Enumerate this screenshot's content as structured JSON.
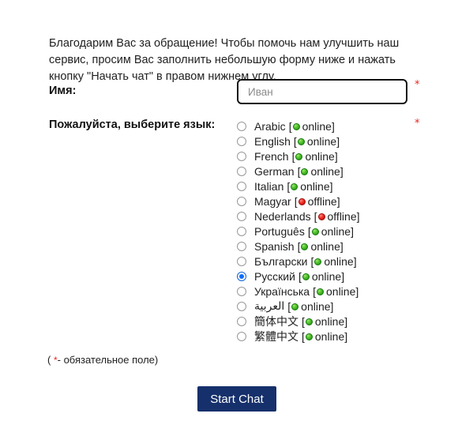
{
  "intro": {
    "text": "Благодарим Вас за обращение! Чтобы помочь нам улучшить наш сервис, просим Вас заполнить небольшую форму ниже и нажать кнопку \"Начать чат\" в правом нижнем углу."
  },
  "form": {
    "name_label": "Имя:",
    "name_value": "",
    "name_placeholder": "Иван",
    "language_label": "Пожалуйста, выберите язык:",
    "required_marker": "*"
  },
  "languages": [
    {
      "label": "Arabic",
      "status": "online",
      "status_text": "online",
      "selected": false
    },
    {
      "label": "English",
      "status": "online",
      "status_text": "online",
      "selected": false
    },
    {
      "label": "French",
      "status": "online",
      "status_text": "online",
      "selected": false
    },
    {
      "label": "German",
      "status": "online",
      "status_text": "online",
      "selected": false
    },
    {
      "label": "Italian",
      "status": "online",
      "status_text": "online",
      "selected": false
    },
    {
      "label": "Magyar",
      "status": "offline",
      "status_text": "offline",
      "selected": false
    },
    {
      "label": "Nederlands",
      "status": "offline",
      "status_text": "offline",
      "selected": false
    },
    {
      "label": "Português",
      "status": "online",
      "status_text": "online",
      "selected": false
    },
    {
      "label": "Spanish",
      "status": "online",
      "status_text": "online",
      "selected": false
    },
    {
      "label": "Български",
      "status": "online",
      "status_text": "online",
      "selected": false
    },
    {
      "label": "Русский",
      "status": "online",
      "status_text": "online",
      "selected": true
    },
    {
      "label": "Українська",
      "status": "online",
      "status_text": "online",
      "selected": false
    },
    {
      "label": "العربية",
      "status": "online",
      "status_text": "online",
      "selected": false
    },
    {
      "label": "簡体中文",
      "status": "online",
      "status_text": "online",
      "selected": false
    },
    {
      "label": "繁體中文",
      "status": "online",
      "status_text": "online",
      "selected": false
    }
  ],
  "footnote": {
    "prefix": "( ",
    "star": "*",
    "suffix": "- обязательное поле)"
  },
  "submit": {
    "label": "Start Chat"
  },
  "colors": {
    "required": "#e8231f",
    "online": "#4cbe2a",
    "offline": "#ef2a22",
    "radio_selected": "#0d6efd",
    "button": "#16306b"
  }
}
